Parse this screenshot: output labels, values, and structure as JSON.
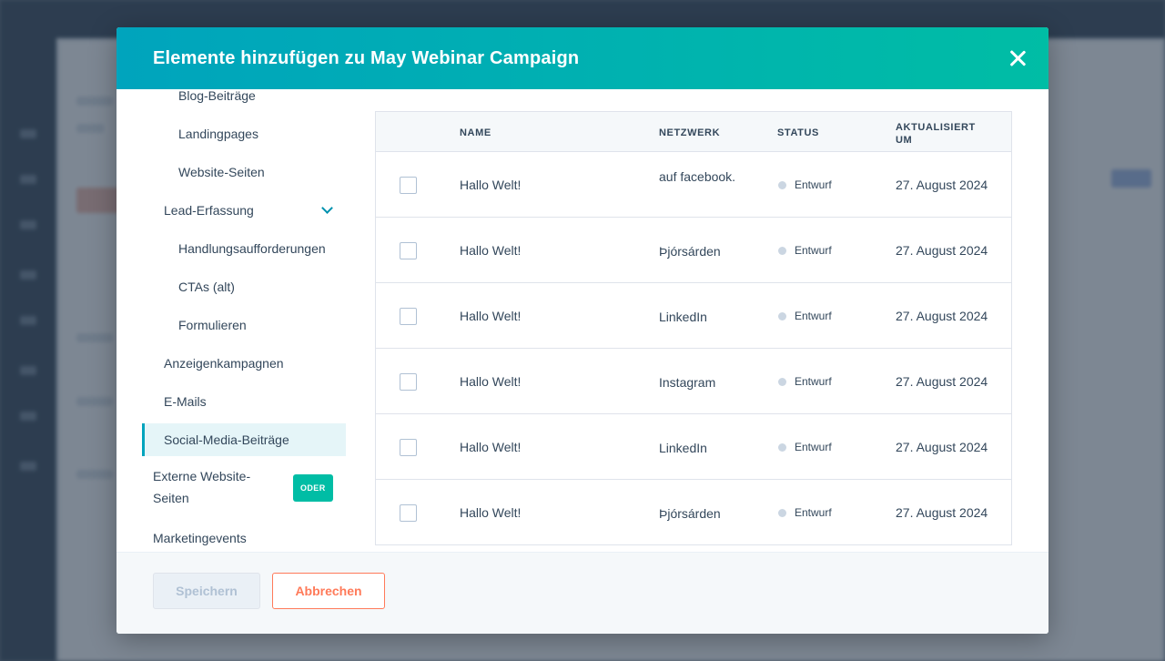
{
  "modal": {
    "title": "Elemente hinzufügen zu May Webinar Campaign"
  },
  "nav": {
    "items": [
      {
        "label": "Blog-Beiträge"
      },
      {
        "label": "Landingpages"
      },
      {
        "label": "Website-Seiten"
      },
      {
        "label": "Lead-Erfassung"
      },
      {
        "label": "Handlungsaufforderungen"
      },
      {
        "label": "CTAs (alt)"
      },
      {
        "label": "Formulieren"
      },
      {
        "label": "Anzeigenkampagnen"
      },
      {
        "label": "E-Mails"
      },
      {
        "label": "Social-Media-Beiträge"
      },
      {
        "label": "Externe Website-Seiten",
        "badge": "ODER"
      },
      {
        "label": "Marketingevents"
      }
    ]
  },
  "table": {
    "headers": {
      "name": "NAME",
      "network": "NETZWERK",
      "status": "STATUS",
      "updated": "AKTUALISIERT UM"
    },
    "rows": [
      {
        "name": "Hallo Welt!",
        "network": "auf facebook.",
        "status": "Entwurf",
        "updated": "27. August 2024"
      },
      {
        "name": "Hallo Welt!",
        "network": "Þjórsárden",
        "status": "Entwurf",
        "updated": "27. August 2024"
      },
      {
        "name": "Hallo Welt!",
        "network": "LinkedIn",
        "status": "Entwurf",
        "updated": "27. August 2024"
      },
      {
        "name": "Hallo Welt!",
        "network": "Instagram",
        "status": "Entwurf",
        "updated": "27. August 2024"
      },
      {
        "name": "Hallo Welt!",
        "network": "LinkedIn",
        "status": "Entwurf",
        "updated": "27. August 2024"
      },
      {
        "name": "Hallo Welt!",
        "network": "Þjórsárden",
        "status": "Entwurf",
        "updated": "27. August 2024"
      }
    ]
  },
  "footer": {
    "save_label": "Speichern",
    "cancel_label": "Abbrechen"
  },
  "colors": {
    "header_gradient_start": "#00a4bd",
    "header_gradient_end": "#00bda5",
    "cancel_accent": "#ff7a59",
    "active_nav_border": "#00a4bd"
  }
}
